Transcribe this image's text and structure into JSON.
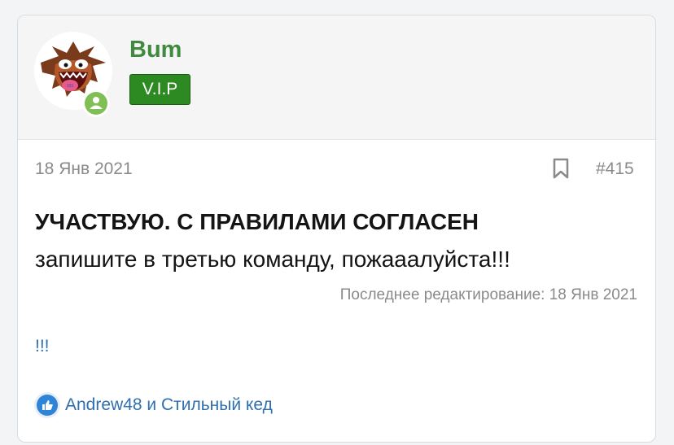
{
  "user": {
    "name": "Bum",
    "badge": "V.I.P"
  },
  "post": {
    "date": "18 Янв 2021",
    "number": "#415",
    "headline": "УЧАСТВУЮ. С ПРАВИЛАМИ СОГЛАСЕН",
    "body": "запишите в третью команду, пожааалуйста!!!",
    "edited": "Последнее редактирование: 18 Янв 2021",
    "extra": "!!!"
  },
  "reactions": {
    "text": "Andrew48 и Стильный кед",
    "icon": "thumbs-up-icon"
  },
  "colors": {
    "username": "#3f8a3f",
    "badge_bg": "#2d8a22",
    "link": "#2f6fb0",
    "online": "#7fbf55"
  }
}
